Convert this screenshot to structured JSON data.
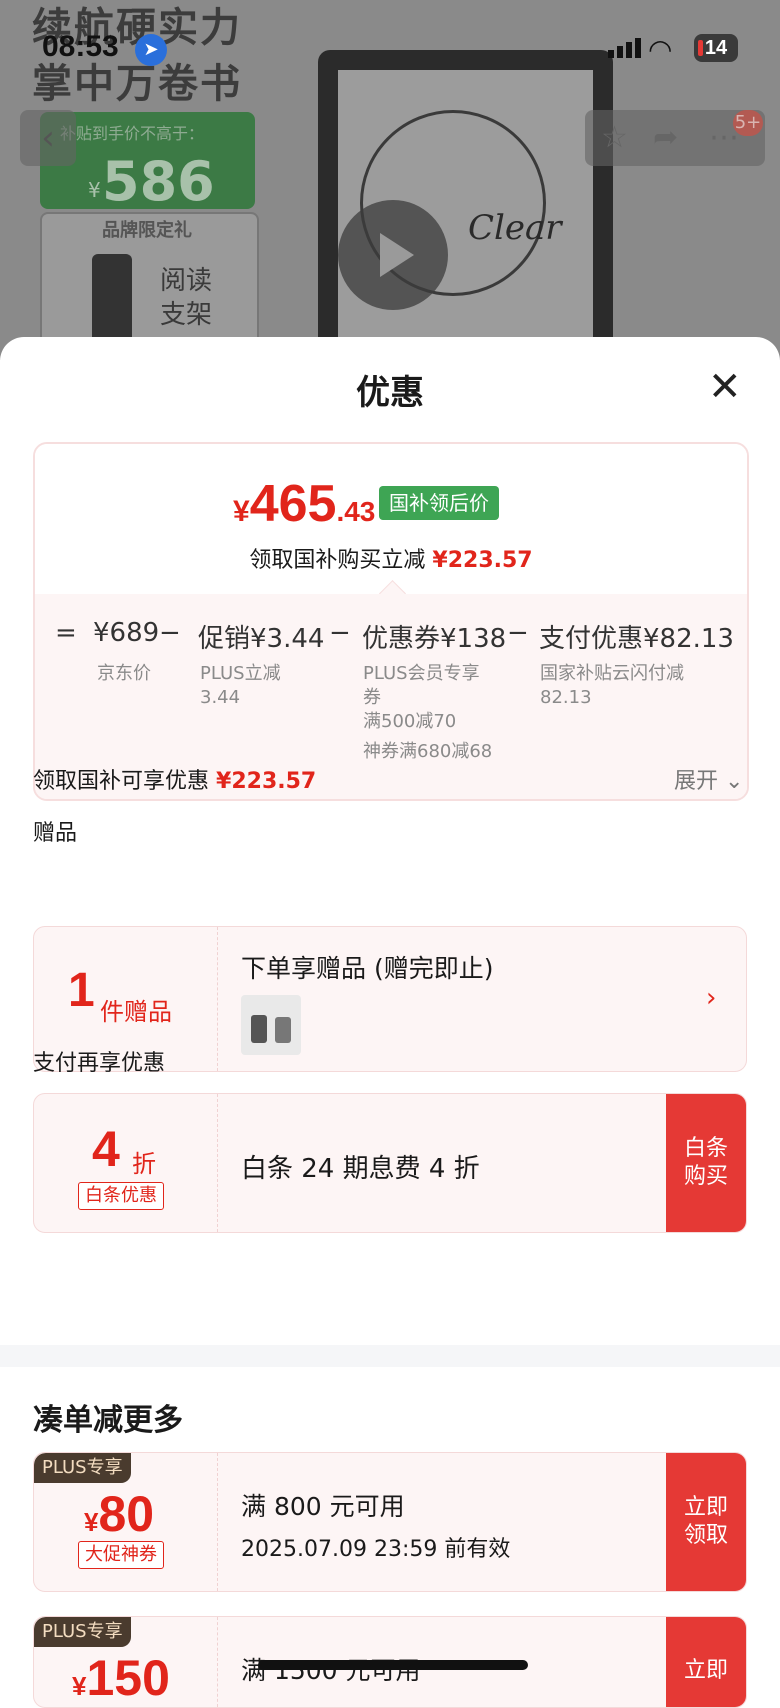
{
  "status_bar": {
    "time": "08:53",
    "battery": "14"
  },
  "backdrop": {
    "headline_line1": "续航硬实力",
    "headline_line2": "掌中万卷书",
    "subsidy_caption": "补贴到手价不高于：",
    "subsidy_price": "586",
    "subsidy_yen": "¥",
    "gift_tag": "品牌限定礼",
    "gift_text_line1": "阅读",
    "gift_text_line2": "支架",
    "device_brand": "Clear",
    "badge": "5+"
  },
  "sheet": {
    "title": "优惠",
    "summary": {
      "price_yen": "¥",
      "price_int": "465",
      "price_dec": ".43",
      "badge": "国补领后价",
      "save_text": "领取国补购买立减",
      "save_amount": "¥223.57",
      "breakdown": {
        "eq": "=",
        "jd_price": "¥689",
        "jd_label": "京东价",
        "minus": "−",
        "promo": "促销¥3.44",
        "promo_note": "PLUS立减\n3.44",
        "coupon": "优惠券¥138",
        "coupon_note1": "PLUS会员专享",
        "coupon_note1b": "券",
        "coupon_note2": "满500减70",
        "coupon_note3": "神券满680减68",
        "pay": "支付优惠¥82.13",
        "pay_note1": "国家补贴云闪付减",
        "pay_note2": "82.13"
      }
    },
    "gb_row": {
      "label": "领取国补可享优惠",
      "amount": "¥223.57",
      "expand": "展开"
    },
    "gift_section": {
      "label": "赠品",
      "count": "1",
      "unit": "件赠品",
      "title": "下单享赠品 (赠完即止)"
    },
    "pay_section": {
      "label": "支付再享优惠",
      "discount_num": "4",
      "discount_unit": "折",
      "tag": "白条优惠",
      "text": "白条 24 期息费 4 折",
      "cta_line1": "白条",
      "cta_line2": "购买"
    },
    "more_section": {
      "title": "凑单减更多",
      "coupons": [
        {
          "plus": "PLUS专享",
          "yen": "¥",
          "amount": "80",
          "tag": "大促神券",
          "condition": "满 800 元可用",
          "valid": "2025.07.09 23:59 前有效",
          "cta_line1": "立即",
          "cta_line2": "领取"
        },
        {
          "plus": "PLUS专享",
          "yen": "¥",
          "amount": "150",
          "condition": "满 1500 元可用",
          "cta_line1": "立即"
        }
      ]
    }
  }
}
